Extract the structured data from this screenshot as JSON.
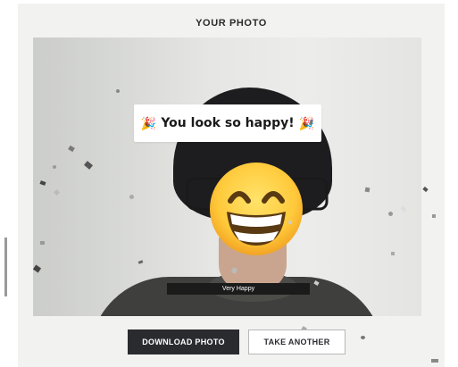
{
  "header": {
    "title": "YOUR PHOTO"
  },
  "photo": {
    "banner_text": "You look so happy!",
    "banner_icon": "party-popper-icon",
    "caption": "Very Happy"
  },
  "actions": {
    "download_label": "DOWNLOAD PHOTO",
    "take_another_label": "TAKE ANOTHER"
  },
  "colors": {
    "panel_bg": "#f2f2f1",
    "primary_button": "#2a2b2f",
    "caption_bg": "#1b1b1b"
  }
}
